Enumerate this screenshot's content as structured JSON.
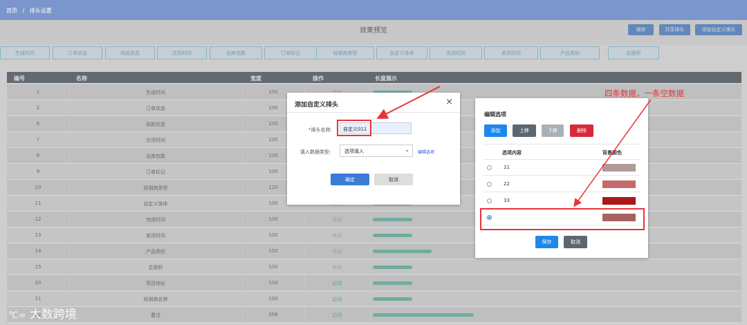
{
  "breadcrumb": {
    "home": "首页",
    "sep": "/",
    "current": "排头设置"
  },
  "preview": {
    "title": "效果预览"
  },
  "actions": {
    "save": "保存",
    "share": "共享排头",
    "add_custom": "添加自定义排头"
  },
  "column_strip": [
    "生成时间",
    "订单状态",
    "收款状态",
    "交货时间",
    "出库包数",
    "订单标记",
    "经销商类型",
    "自定义排序",
    "完成时间",
    "发货时间",
    "产品类别",
    "总面积"
  ],
  "table": {
    "headers": {
      "id": "编号",
      "name": "名称",
      "width": "宽度",
      "op": "操作",
      "len": "长度展示"
    },
    "rows": [
      {
        "id": "1",
        "name": "生成时间",
        "width": "100",
        "op": "禁用",
        "len": 100
      },
      {
        "id": "2",
        "name": "订单状态",
        "width": "100",
        "op": "禁用",
        "len": 100
      },
      {
        "id": "6",
        "name": "收款状态",
        "width": "100",
        "op": "禁用",
        "len": 100
      },
      {
        "id": "7",
        "name": "交货时间",
        "width": "100",
        "op": "禁用",
        "len": 100
      },
      {
        "id": "8",
        "name": "出库包数",
        "width": "100",
        "op": "禁用",
        "len": 100
      },
      {
        "id": "9",
        "name": "订单标记",
        "width": "100",
        "op": "禁用",
        "len": 100
      },
      {
        "id": "10",
        "name": "经销商类型",
        "width": "120",
        "op": "禁用",
        "len": 120
      },
      {
        "id": "11",
        "name": "自定义排序",
        "width": "100",
        "op": "禁用",
        "len": 100
      },
      {
        "id": "12",
        "name": "完成时间",
        "width": "100",
        "op": "禁用",
        "len": 100
      },
      {
        "id": "13",
        "name": "发货时间",
        "width": "100",
        "op": "禁用",
        "len": 100
      },
      {
        "id": "14",
        "name": "产品类别",
        "width": "150",
        "op": "禁用",
        "len": 150
      },
      {
        "id": "15",
        "name": "总面积",
        "width": "100",
        "op": "禁用",
        "len": 100
      },
      {
        "id": "20",
        "name": "项目地址",
        "width": "100",
        "op": "启用",
        "len": 100
      },
      {
        "id": "21",
        "name": "经销商名称",
        "width": "100",
        "op": "启用",
        "len": 100
      },
      {
        "id": "22",
        "name": "备注",
        "width": "256",
        "op": "启用",
        "len": 256
      }
    ]
  },
  "add_dialog": {
    "title": "添加自定义排头",
    "close": "×",
    "name_label": "*排头名称:",
    "name_value": "自定义011",
    "type_label": "填入数据类型:",
    "type_value": "选项填入",
    "edit_link": "编辑选项",
    "ok": "确定",
    "cancel": "取消"
  },
  "options_dialog": {
    "title": "编辑选项",
    "buttons": {
      "add": "添加",
      "up": "上移",
      "down": "下移",
      "delete": "删除"
    },
    "col_content": "选项内容",
    "col_color": "背景颜色",
    "options": [
      {
        "text": "11",
        "color": "#b09a9a",
        "selected": false
      },
      {
        "text": "22",
        "color": "#c46a6a",
        "selected": false
      },
      {
        "text": "33",
        "color": "#a81818",
        "selected": false
      },
      {
        "text": "",
        "color": "#a86060",
        "selected": true
      }
    ],
    "save": "保存",
    "cancel": "取消"
  },
  "annotation": {
    "text": "四条数据，一条空数据"
  },
  "watermark": {
    "text": "大数跨境"
  },
  "colors": {
    "topbar": "#7b96cc",
    "primary": "#3a7bd5",
    "danger": "#e8333a",
    "annotation": "#e8333a",
    "bar": "#6fbfb1"
  }
}
